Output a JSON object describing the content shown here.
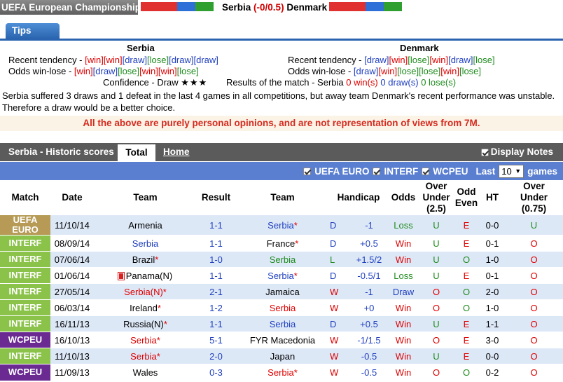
{
  "header": {
    "competition": "UEFA European Championship",
    "home_team": "Serbia",
    "handicap": "(-0/0.5)",
    "away_team": "Denmark",
    "left_strip_colors": [
      "#e03030",
      "#e03030",
      "#2f6fd8",
      "#2fa030"
    ],
    "right_strip_colors": [
      "#e03030",
      "#e03030",
      "#2f6fd8",
      "#2fa030"
    ]
  },
  "tips": {
    "tab_label": "Tips",
    "home": {
      "name": "Serbia",
      "tendency_label": "Recent tendency - ",
      "tendency": [
        "win",
        "win",
        "draw",
        "lose",
        "draw",
        "draw"
      ],
      "odds_label": "Odds win-lose - ",
      "odds": [
        "win",
        "draw",
        "lose",
        "win",
        "win",
        "lose"
      ]
    },
    "away": {
      "name": "Denmark",
      "tendency_label": "Recent tendency - ",
      "tendency": [
        "draw",
        "win",
        "lose",
        "win",
        "draw",
        "lose"
      ],
      "odds_label": "Odds win-lose - ",
      "odds": [
        "draw",
        "win",
        "lose",
        "lose",
        "win",
        "lose"
      ]
    },
    "confidence_label": "Confidence - Draw ",
    "confidence_stars": "★★★",
    "results_label": "Results of the match - Serbia ",
    "results_win": "0 win(s)",
    "results_draw": "0 draw(s)",
    "results_lose": "0 lose(s)",
    "summary_line1": "Serbia suffered 3 draws and 1 defeat in the last 4 games in all competitions, but away team Denmark's recent performance was unstable.",
    "summary_line2": "Therefore a draw would be a better choice.",
    "disclaimer": "All the above are purely personal opinions, and are not representation of views from 7M."
  },
  "history": {
    "title": "Serbia - Historic scores",
    "tab_total": "Total",
    "tab_home": "Home",
    "display_notes": "Display Notes",
    "filters": [
      "UEFA EURO",
      "INTERF",
      "WCPEU"
    ],
    "last_label": "Last",
    "last_value": "10",
    "games_label": "games",
    "columns": {
      "match": "Match",
      "date": "Date",
      "team": "Team",
      "result": "Result",
      "team2": "Team",
      "handicap": "Handicap",
      "odds": "Odds",
      "over_under_l1": "Over",
      "over_under_l2": "Under",
      "over_under_l3": "(2.5)",
      "odd_even_l1": "Odd",
      "odd_even_l2": "Even",
      "ht": "HT",
      "ou2_l1": "Over",
      "ou2_l2": "Under",
      "ou2_l3": "(0.75)"
    },
    "comp_colors": {
      "UEFA EURO": "#b69a55",
      "INTERF": "#8bc34a",
      "WCPEU": "#6a2a92"
    },
    "rows": [
      {
        "comp": "UEFA EURO",
        "date": "11/10/14",
        "home": "Armenia",
        "home_star": false,
        "home_cls": "",
        "result": "1-1",
        "away": "Serbia",
        "away_star": true,
        "away_cls": "res",
        "wdl": "D",
        "hcap": "-1",
        "odds": "Loss",
        "ou": "U",
        "oe": "E",
        "ht": "0-0",
        "ou2": "U"
      },
      {
        "comp": "INTERF",
        "date": "08/09/14",
        "home": "Serbia",
        "home_star": false,
        "home_cls": "res",
        "result": "1-1",
        "away": "France",
        "away_star": true,
        "away_cls": "",
        "wdl": "D",
        "hcap": "+0.5",
        "odds": "Win",
        "ou": "U",
        "oe": "E",
        "ht": "0-1",
        "ou2": "O"
      },
      {
        "comp": "INTERF",
        "date": "07/06/14",
        "home": "Brazil",
        "home_star": true,
        "home_cls": "",
        "result": "1-0",
        "away": "Serbia",
        "away_star": false,
        "away_cls": "l",
        "wdl": "L",
        "hcap": "+1.5/2",
        "odds": "Win",
        "ou": "U",
        "oe": "O",
        "ht": "1-0",
        "ou2": "O"
      },
      {
        "comp": "INTERF",
        "date": "01/06/14",
        "home": "Panama(N)",
        "home_star": false,
        "home_cls": "",
        "home_flag": true,
        "result": "1-1",
        "away": "Serbia",
        "away_star": true,
        "away_cls": "res",
        "wdl": "D",
        "hcap": "-0.5/1",
        "odds": "Loss",
        "ou": "U",
        "oe": "E",
        "ht": "0-1",
        "ou2": "O"
      },
      {
        "comp": "INTERF",
        "date": "27/05/14",
        "home": "Serbia(N)",
        "home_star": true,
        "home_cls": "w",
        "result": "2-1",
        "away": "Jamaica",
        "away_star": false,
        "away_cls": "",
        "wdl": "W",
        "hcap": "-1",
        "odds": "Draw",
        "ou": "O",
        "oe": "O",
        "ht": "2-0",
        "ou2": "O"
      },
      {
        "comp": "INTERF",
        "date": "06/03/14",
        "home": "Ireland",
        "home_star": true,
        "home_cls": "",
        "result": "1-2",
        "away": "Serbia",
        "away_star": false,
        "away_cls": "w",
        "wdl": "W",
        "hcap": "+0",
        "odds": "Win",
        "ou": "O",
        "oe": "O",
        "ht": "1-0",
        "ou2": "O"
      },
      {
        "comp": "INTERF",
        "date": "16/11/13",
        "home": "Russia(N)",
        "home_star": true,
        "home_cls": "",
        "result": "1-1",
        "away": "Serbia",
        "away_star": false,
        "away_cls": "res",
        "wdl": "D",
        "hcap": "+0.5",
        "odds": "Win",
        "ou": "U",
        "oe": "E",
        "ht": "1-1",
        "ou2": "O"
      },
      {
        "comp": "WCPEU",
        "date": "16/10/13",
        "home": "Serbia",
        "home_star": true,
        "home_cls": "w",
        "result": "5-1",
        "away": "FYR Macedonia",
        "away_star": false,
        "away_cls": "",
        "wdl": "W",
        "hcap": "-1/1.5",
        "odds": "Win",
        "ou": "O",
        "oe": "E",
        "ht": "3-0",
        "ou2": "O"
      },
      {
        "comp": "INTERF",
        "date": "11/10/13",
        "home": "Serbia",
        "home_star": true,
        "home_cls": "w",
        "result": "2-0",
        "away": "Japan",
        "away_star": false,
        "away_cls": "",
        "wdl": "W",
        "hcap": "-0.5",
        "odds": "Win",
        "ou": "U",
        "oe": "E",
        "ht": "0-0",
        "ou2": "O"
      },
      {
        "comp": "WCPEU",
        "date": "11/09/13",
        "home": "Wales",
        "home_star": false,
        "home_cls": "",
        "result": "0-3",
        "away": "Serbia",
        "away_star": true,
        "away_cls": "w",
        "wdl": "W",
        "hcap": "-0.5",
        "odds": "Win",
        "ou": "O",
        "oe": "O",
        "ht": "0-2",
        "ou2": "O"
      }
    ]
  }
}
